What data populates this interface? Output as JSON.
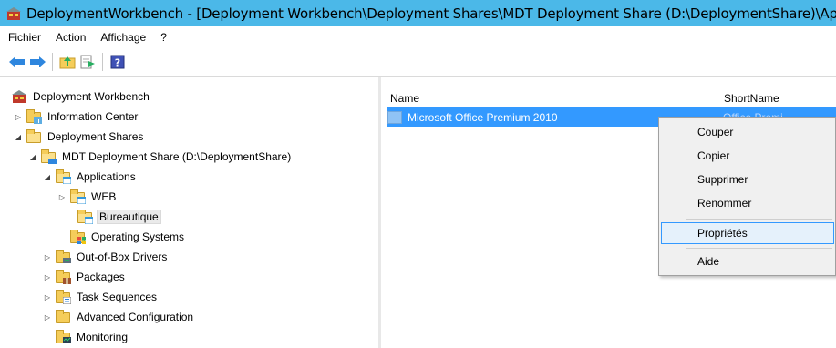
{
  "window": {
    "title": "DeploymentWorkbench - [Deployment Workbench\\Deployment Shares\\MDT Deployment Share (D:\\DeploymentShare)\\Applications\\Bureautique]",
    "title_bar_color": "#4bb8e8"
  },
  "menubar": {
    "items": [
      "Fichier",
      "Action",
      "Affichage",
      "?"
    ]
  },
  "toolbar": {
    "buttons": [
      "back-icon",
      "forward-icon",
      "up-folder-icon",
      "export-list-icon",
      "help-icon"
    ]
  },
  "tree": {
    "nodes": [
      {
        "label": "Deployment Workbench",
        "icon": "workbench-icon",
        "expander": "none"
      },
      {
        "label": "Information Center",
        "icon": "info-center-icon",
        "expander": "collapsed"
      },
      {
        "label": "Deployment Shares",
        "icon": "folder-icon",
        "expander": "expanded"
      },
      {
        "label": "MDT Deployment Share (D:\\DeploymentShare)",
        "icon": "share-folder-icon",
        "expander": "expanded"
      },
      {
        "label": "Applications",
        "icon": "applications-folder-icon",
        "expander": "expanded"
      },
      {
        "label": "WEB",
        "icon": "folder-icon",
        "expander": "collapsed"
      },
      {
        "label": "Bureautique",
        "icon": "folder-icon",
        "expander": "none",
        "selected": true
      },
      {
        "label": "Operating Systems",
        "icon": "os-folder-icon",
        "expander": "none"
      },
      {
        "label": "Out-of-Box Drivers",
        "icon": "drivers-folder-icon",
        "expander": "collapsed"
      },
      {
        "label": "Packages",
        "icon": "packages-folder-icon",
        "expander": "collapsed"
      },
      {
        "label": "Task Sequences",
        "icon": "task-sequences-icon",
        "expander": "collapsed"
      },
      {
        "label": "Advanced Configuration",
        "icon": "folder-icon",
        "expander": "collapsed"
      },
      {
        "label": "Monitoring",
        "icon": "monitoring-folder-icon",
        "expander": "none"
      }
    ]
  },
  "list": {
    "columns": [
      "Name",
      "ShortName"
    ],
    "rows": [
      {
        "name": "Microsoft Office Premium 2010",
        "short": "Office Premi..."
      }
    ]
  },
  "context_menu": {
    "items": [
      "Couper",
      "Copier",
      "Supprimer",
      "Renommer",
      "Propriétés",
      "Aide"
    ],
    "hovered": "Propriétés"
  }
}
